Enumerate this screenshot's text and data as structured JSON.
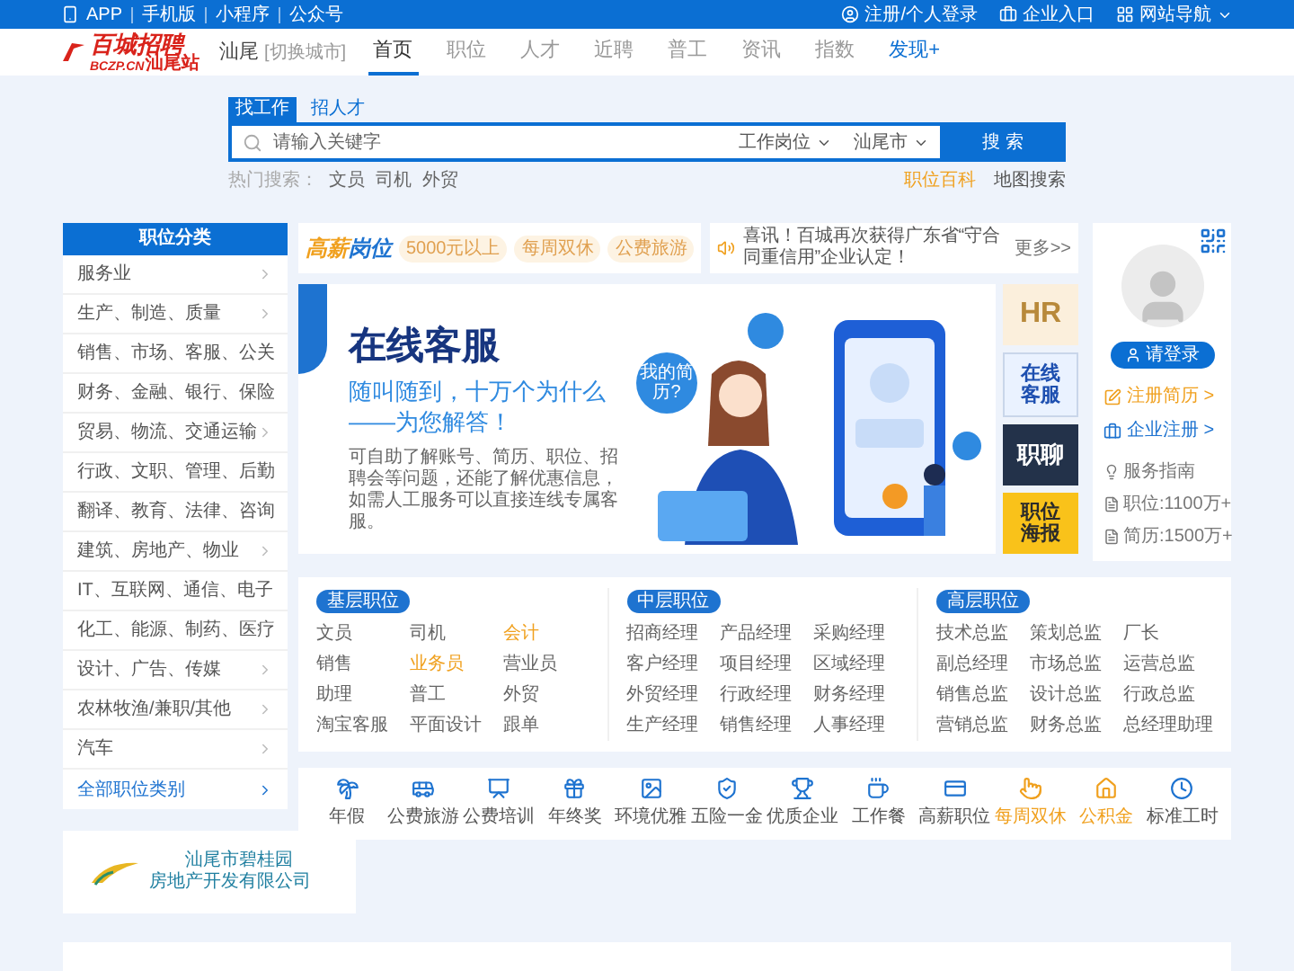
{
  "top_bar": {
    "left_links": [
      "APP",
      "手机版",
      "小程序",
      "公众号"
    ],
    "right_links": [
      {
        "kind": "user",
        "label": "注册/个人登录"
      },
      {
        "kind": "company",
        "label": "企业入口"
      },
      {
        "kind": "nav",
        "label": "网站导航"
      }
    ]
  },
  "header": {
    "logo_name": "百城招聘",
    "logo_domain": "BCZP.CN",
    "logo_station": "汕尾站",
    "city": "汕尾",
    "switch_city": "[切换城市]",
    "nav": [
      {
        "label": "首页",
        "selected": true,
        "highlight": false
      },
      {
        "label": "职位",
        "selected": false,
        "highlight": false
      },
      {
        "label": "人才",
        "selected": false,
        "highlight": false
      },
      {
        "label": "近聘",
        "selected": false,
        "highlight": false
      },
      {
        "label": "普工",
        "selected": false,
        "highlight": false
      },
      {
        "label": "资讯",
        "selected": false,
        "highlight": false
      },
      {
        "label": "指数",
        "selected": false,
        "highlight": false
      },
      {
        "label": "发现+",
        "selected": false,
        "highlight": true
      }
    ]
  },
  "search": {
    "tabs": [
      {
        "label": "找工作",
        "selected": true
      },
      {
        "label": "招人才",
        "selected": false
      }
    ],
    "placeholder": "请输入关键字",
    "dropdowns": [
      "工作岗位",
      "汕尾市"
    ],
    "button": "搜 索",
    "hot_label": "热门搜索：",
    "hot_words": [
      "文员",
      "司机",
      "外贸"
    ],
    "links": [
      {
        "label": "职位百科",
        "highlight": true
      },
      {
        "label": "地图搜索",
        "highlight": false
      }
    ]
  },
  "categories": {
    "title": "职位分类",
    "items": [
      "服务业",
      "生产、制造、质量",
      "销售、市场、客服、公关",
      "财务、金融、银行、保险",
      "贸易、物流、交通运输",
      "行政、文职、管理、后勤",
      "翻译、教育、法律、咨询",
      "建筑、房地产、物业",
      "IT、互联网、通信、电子",
      "化工、能源、制药、医疗",
      "设计、广告、传媒",
      "农林牧渔/兼职/其他",
      "汽车"
    ],
    "all_label": "全部职位类别"
  },
  "company_ad": {
    "name_line1": "汕尾市碧桂园",
    "name_line2": "房地产开发有限公司"
  },
  "promo": {
    "logo_a": "高薪",
    "logo_b": "岗位",
    "tags": [
      "5000元以上",
      "每周双休",
      "公费旅游"
    ]
  },
  "news": {
    "text": "喜讯！百城再次获得广东省“守合同重信用”企业认定！",
    "more": "更多>>"
  },
  "banner": {
    "title": "在线客服",
    "subtitle_lines": [
      "随叫随到，十万个为什么",
      "——为您解答！"
    ],
    "description": "可自助了解账号、简历、职位、招聘会等问题，还能了解优惠信息，如需人工服务可以直接连线专属客服。",
    "bubble": "我的简历?"
  },
  "side_tiles": [
    {
      "kind": "hr",
      "label": "HR"
    },
    {
      "kind": "service",
      "label": "在线客服"
    },
    {
      "kind": "chat",
      "label": "职聊"
    },
    {
      "kind": "poster",
      "label": "职位海报"
    }
  ],
  "user_card": {
    "login": "请登录",
    "links": [
      {
        "kind": "resume",
        "label": "注册简历 >"
      },
      {
        "kind": "company",
        "label": "企业注册 >"
      }
    ],
    "stats": [
      {
        "kind": "guide",
        "label": "服务指南"
      },
      {
        "kind": "jobs",
        "label": "职位:1100万+"
      },
      {
        "kind": "resumes",
        "label": "简历:1500万+"
      }
    ]
  },
  "job_groups": [
    {
      "title": "基层职位",
      "items": [
        {
          "label": "文员",
          "highlight": false
        },
        {
          "label": "司机",
          "highlight": false
        },
        {
          "label": "会计",
          "highlight": true
        },
        {
          "label": "销售",
          "highlight": false
        },
        {
          "label": "业务员",
          "highlight": true
        },
        {
          "label": "营业员",
          "highlight": false
        },
        {
          "label": "助理",
          "highlight": false
        },
        {
          "label": "普工",
          "highlight": false
        },
        {
          "label": "外贸",
          "highlight": false
        },
        {
          "label": "淘宝客服",
          "highlight": false
        },
        {
          "label": "平面设计",
          "highlight": false
        },
        {
          "label": "跟单",
          "highlight": false
        }
      ]
    },
    {
      "title": "中层职位",
      "items": [
        {
          "label": "招商经理",
          "highlight": false
        },
        {
          "label": "产品经理",
          "highlight": false
        },
        {
          "label": "采购经理",
          "highlight": false
        },
        {
          "label": "客户经理",
          "highlight": false
        },
        {
          "label": "项目经理",
          "highlight": false
        },
        {
          "label": "区域经理",
          "highlight": false
        },
        {
          "label": "外贸经理",
          "highlight": false
        },
        {
          "label": "行政经理",
          "highlight": false
        },
        {
          "label": "财务经理",
          "highlight": false
        },
        {
          "label": "生产经理",
          "highlight": false
        },
        {
          "label": "销售经理",
          "highlight": false
        },
        {
          "label": "人事经理",
          "highlight": false
        }
      ]
    },
    {
      "title": "高层职位",
      "items": [
        {
          "label": "技术总监",
          "highlight": false
        },
        {
          "label": "策划总监",
          "highlight": false
        },
        {
          "label": "厂长",
          "highlight": false
        },
        {
          "label": "副总经理",
          "highlight": false
        },
        {
          "label": "市场总监",
          "highlight": false
        },
        {
          "label": "运营总监",
          "highlight": false
        },
        {
          "label": "销售总监",
          "highlight": false
        },
        {
          "label": "设计总监",
          "highlight": false
        },
        {
          "label": "行政总监",
          "highlight": false
        },
        {
          "label": "营销总监",
          "highlight": false
        },
        {
          "label": "财务总监",
          "highlight": false
        },
        {
          "label": "总经理助理",
          "highlight": false
        }
      ]
    }
  ],
  "benefits": [
    {
      "kind": "palm",
      "label": "年假",
      "highlight": false
    },
    {
      "kind": "bus",
      "label": "公费旅游",
      "highlight": false
    },
    {
      "kind": "board",
      "label": "公费培训",
      "highlight": false
    },
    {
      "kind": "gift",
      "label": "年终奖",
      "highlight": false
    },
    {
      "kind": "image",
      "label": "环境优雅",
      "highlight": false
    },
    {
      "kind": "shield",
      "label": "五险一金",
      "highlight": false
    },
    {
      "kind": "trophy",
      "label": "优质企业",
      "highlight": false
    },
    {
      "kind": "coffee",
      "label": "工作餐",
      "highlight": false
    },
    {
      "kind": "card",
      "label": "高薪职位",
      "highlight": false
    },
    {
      "kind": "hand",
      "label": "每周双休",
      "highlight": true
    },
    {
      "kind": "home",
      "label": "公积金",
      "highlight": true
    },
    {
      "kind": "clock",
      "label": "标准工时",
      "highlight": false
    }
  ]
}
